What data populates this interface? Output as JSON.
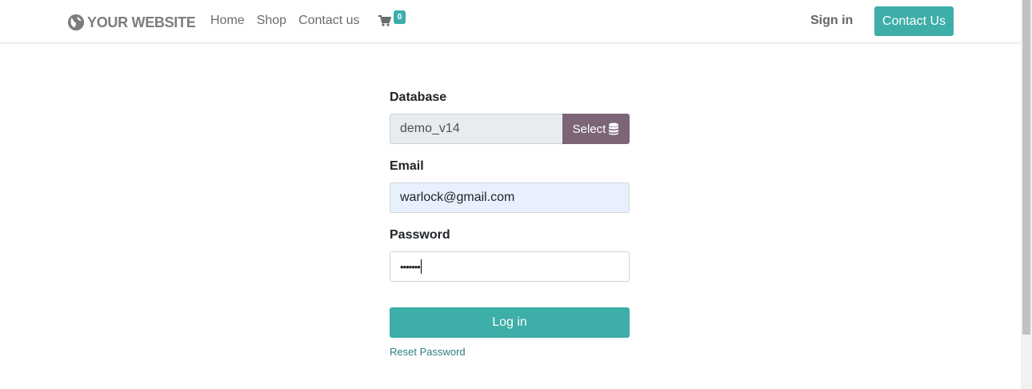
{
  "header": {
    "logo_text": "YOUR WEBSITE",
    "nav": [
      "Home",
      "Shop",
      "Contact us"
    ],
    "cart_count": "0",
    "sign_in": "Sign in",
    "contact_button": "Contact Us"
  },
  "form": {
    "database_label": "Database",
    "database_value": "demo_v14",
    "select_button": "Select",
    "email_label": "Email",
    "email_value": "warlock@gmail.com",
    "password_label": "Password",
    "password_value": "•••••••",
    "login_button": "Log in",
    "reset_link": "Reset Password"
  },
  "icons": {
    "logo": "globe-icon",
    "cart": "shopping-cart-icon",
    "select": "database-icon"
  },
  "colors": {
    "accent": "#3daea8",
    "select_button": "#7b6576",
    "autofill_bg": "#e8f0fe"
  }
}
